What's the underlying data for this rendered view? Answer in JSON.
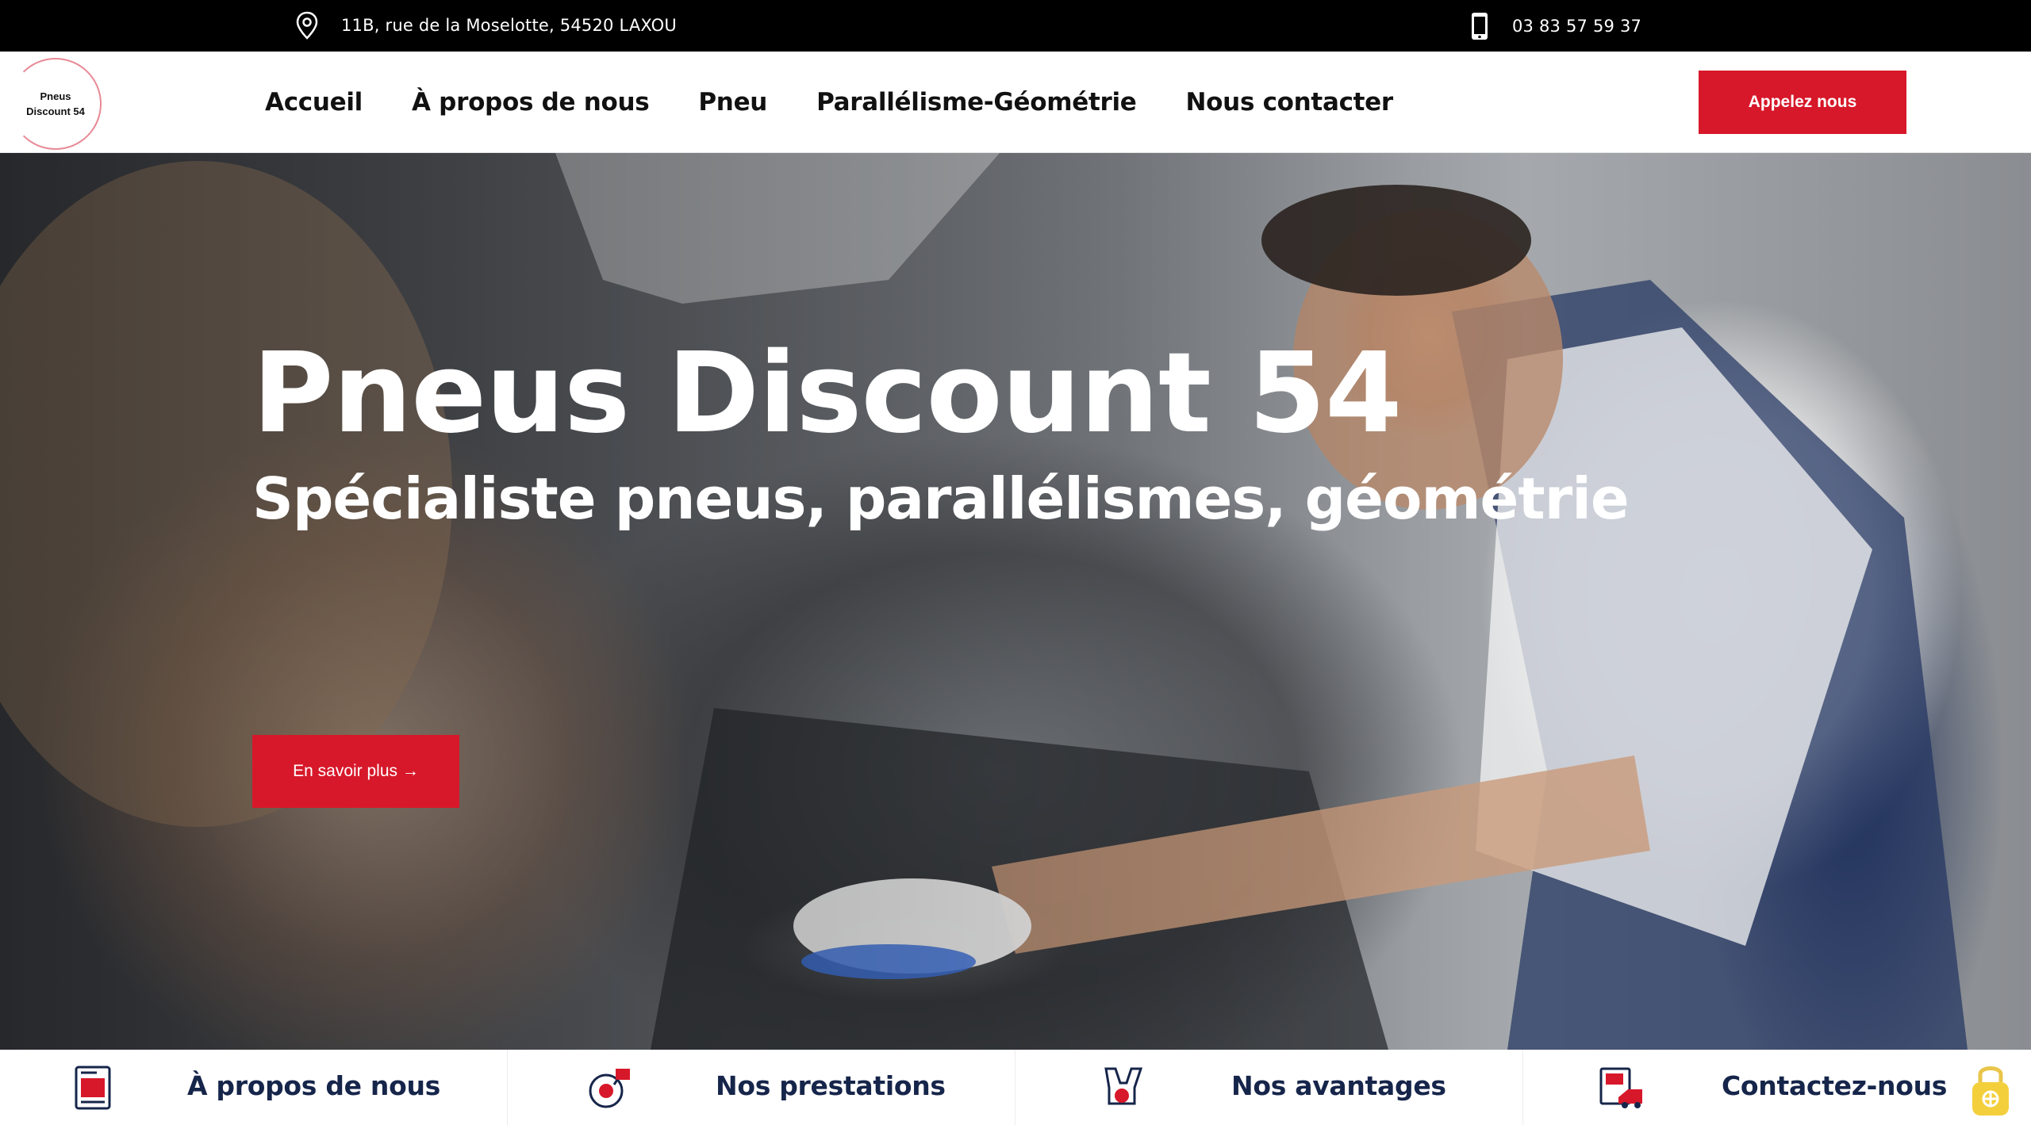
{
  "topbar": {
    "address": "11B, rue de la Moselotte, 54520 LAXOU",
    "phone": "03 83 57 59 37",
    "address_icon": "map-pin-icon",
    "phone_icon": "mobile-phone-icon"
  },
  "logo": {
    "line1": "Pneus",
    "line2": "Discount 54"
  },
  "nav": {
    "items": [
      {
        "label": "Accueil"
      },
      {
        "label": "À propos de nous"
      },
      {
        "label": "Pneu"
      },
      {
        "label": "Parallélisme-Géométrie"
      },
      {
        "label": "Nous contacter"
      }
    ]
  },
  "header": {
    "cta_label": "Appelez nous"
  },
  "hero": {
    "title": "Pneus Discount 54",
    "subtitle": "Spécialiste pneus, parallélismes, géométrie",
    "button_label": "En savoir plus →"
  },
  "quicklinks": [
    {
      "label": "À propos de nous",
      "icon": "document-icon"
    },
    {
      "label": "Nos prestations",
      "icon": "turbo-icon"
    },
    {
      "label": "Nos avantages",
      "icon": "engine-icon"
    },
    {
      "label": "Contactez-nous",
      "icon": "repair-report-icon"
    }
  ],
  "colors": {
    "accent": "#d7182a",
    "navy": "#16254a",
    "topbar": "#000000"
  }
}
